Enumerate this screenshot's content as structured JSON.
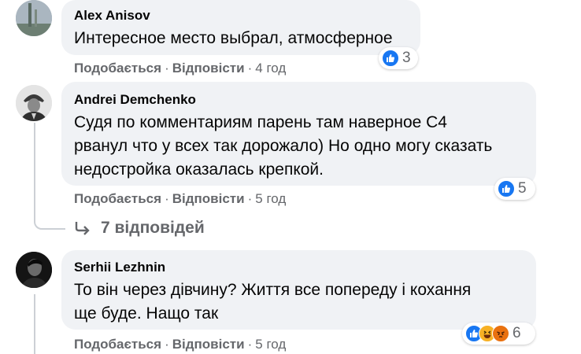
{
  "comments": [
    {
      "author": "Alex Anisov",
      "text": "Интересное место выбрал, атмосферное",
      "like_label": "Подобається",
      "reply_label": "Відповісти",
      "time": "4 год",
      "reaction_count": "3",
      "reaction_icons": [
        "like-icon"
      ]
    },
    {
      "author": "Andrei Demchenko",
      "text_lines": [
        "Судя по комментариям парень там наверное С4",
        "рванул что у всех так дорожало) Но одно могу сказать",
        "недостройка оказалась крепкой."
      ],
      "like_label": "Подобається",
      "reply_label": "Відповісти",
      "time": "5 год",
      "reaction_count": "5",
      "reaction_icons": [
        "like-icon"
      ],
      "replies_label": "7 відповідей"
    },
    {
      "author": "Serhii Lezhnin",
      "text_lines": [
        "То він через дівчину? Життя все попереду і кохання",
        "ще буде. Нащо так"
      ],
      "like_label": "Подобається",
      "reply_label": "Відповісти",
      "time": "5 год",
      "reaction_count": "6",
      "reaction_icons": [
        "like-icon",
        "haha-icon",
        "angry-icon"
      ]
    }
  ],
  "separator": "·",
  "colors": {
    "like": "#1877f2",
    "haha": "#f7b125",
    "angry": "#e9710f",
    "bubble": "#f0f2f5",
    "meta": "#65676b"
  }
}
